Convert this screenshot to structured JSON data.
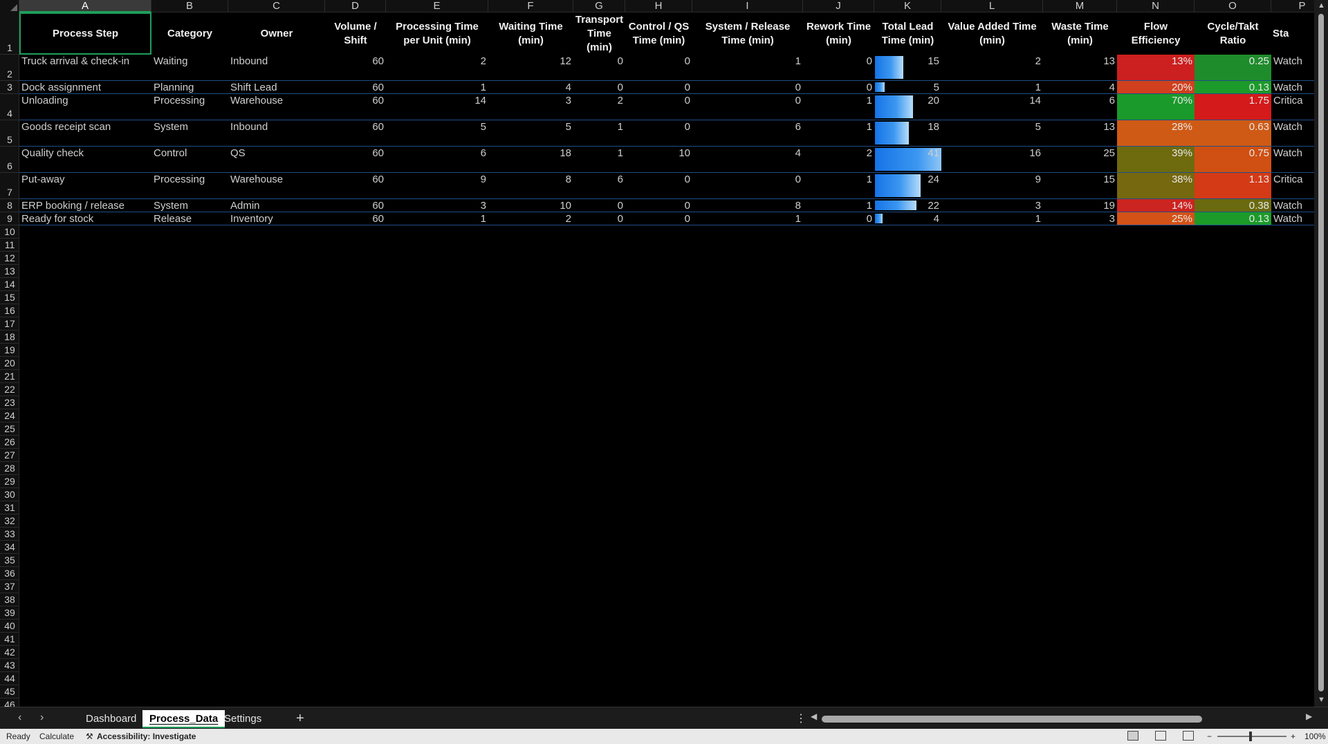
{
  "columns": [
    "A",
    "B",
    "C",
    "D",
    "E",
    "F",
    "G",
    "H",
    "I",
    "J",
    "K",
    "L",
    "M",
    "N",
    "O",
    "P"
  ],
  "headers": [
    "Process Step",
    "Category",
    "Owner",
    "Volume / Shift",
    "Processing Time per Unit (min)",
    "Waiting Time (min)",
    "Transport Time (min)",
    "Control / QS Time (min)",
    "System / Release Time (min)",
    "Rework Time (min)",
    "Total Lead Time (min)",
    "Value Added Time (min)",
    "Waste Time (min)",
    "Flow Efficiency",
    "Cycle/Takt Ratio",
    "Sta"
  ],
  "rows": [
    {
      "cells": [
        "Truck arrival & check-in",
        "Waiting",
        "Inbound",
        "60",
        "2",
        "12",
        "0",
        "0",
        "1",
        "0",
        "15",
        "2",
        "13",
        "13%",
        "0.25",
        "Watch"
      ],
      "lead_bar_fraction": 0.366,
      "flow_color": "#cc1f1f",
      "ratio_color": "#1f8c2c"
    },
    {
      "cells": [
        "Dock assignment",
        "Planning",
        "Shift Lead",
        "60",
        "1",
        "4",
        "0",
        "0",
        "0",
        "0",
        "5",
        "1",
        "4",
        "20%",
        "0.13",
        "Watch"
      ],
      "lead_bar_fraction": 0.122,
      "flow_color": "#d0401e",
      "ratio_color": "#1c9a2a"
    },
    {
      "cells": [
        "Unloading",
        "Processing",
        "Warehouse",
        "60",
        "14",
        "3",
        "2",
        "0",
        "0",
        "1",
        "20",
        "14",
        "6",
        "70%",
        "1.75",
        "Critica"
      ],
      "lead_bar_fraction": 0.488,
      "flow_color": "#1a9a2a",
      "ratio_color": "#d41a1a"
    },
    {
      "cells": [
        "Goods receipt scan",
        "System",
        "Inbound",
        "60",
        "5",
        "5",
        "1",
        "0",
        "6",
        "1",
        "18",
        "5",
        "13",
        "28%",
        "0.63",
        "Watch"
      ],
      "lead_bar_fraction": 0.439,
      "flow_color": "#cf5a15",
      "ratio_color": "#cf5a15"
    },
    {
      "cells": [
        "Quality check",
        "Control",
        "QS",
        "60",
        "6",
        "18",
        "1",
        "10",
        "4",
        "2",
        "41",
        "16",
        "25",
        "39%",
        "0.75",
        "Watch"
      ],
      "lead_bar_fraction": 1.0,
      "flow_color": "#6e6a0e",
      "ratio_color": "#cf5012"
    },
    {
      "cells": [
        "Put-away",
        "Processing",
        "Warehouse",
        "60",
        "9",
        "8",
        "6",
        "0",
        "0",
        "1",
        "24",
        "9",
        "15",
        "38%",
        "1.13",
        "Critica"
      ],
      "lead_bar_fraction": 0.585,
      "flow_color": "#76680e",
      "ratio_color": "#d43a16"
    },
    {
      "cells": [
        "ERP booking / release",
        "System",
        "Admin",
        "60",
        "3",
        "10",
        "0",
        "0",
        "8",
        "1",
        "22",
        "3",
        "19",
        "14%",
        "0.38",
        "Watch"
      ],
      "lead_bar_fraction": 0.537,
      "flow_color": "#cc2420",
      "ratio_color": "#6a6a10"
    },
    {
      "cells": [
        "Ready for stock",
        "Release",
        "Inventory",
        "60",
        "1",
        "2",
        "0",
        "0",
        "1",
        "0",
        "4",
        "1",
        "3",
        "25%",
        "0.13",
        "Watch"
      ],
      "lead_bar_fraction": 0.098,
      "flow_color": "#d35217",
      "ratio_color": "#1c9a2a"
    }
  ],
  "row_numbers": [
    "1",
    "2",
    "3",
    "4",
    "5",
    "6",
    "7",
    "8",
    "9",
    "10",
    "11",
    "12",
    "13",
    "14",
    "15",
    "16",
    "17",
    "18",
    "19",
    "20",
    "21",
    "22",
    "23",
    "24",
    "25",
    "26",
    "27",
    "28",
    "29",
    "30",
    "31",
    "32",
    "33",
    "34",
    "35",
    "36",
    "37",
    "38",
    "39",
    "40",
    "41",
    "42",
    "43",
    "44",
    "45",
    "46"
  ],
  "sheet_tabs": [
    {
      "label": "Dashboard",
      "active": false
    },
    {
      "label": "Process_Data",
      "active": true
    },
    {
      "label": "Settings",
      "active": false
    }
  ],
  "status": {
    "ready": "Ready",
    "calculate": "Calculate",
    "accessibility": "Accessibility: Investigate",
    "zoom": "100%"
  },
  "icons": {
    "prev_sheet": "chevron-left-icon",
    "next_sheet": "chevron-right-icon",
    "add_sheet": "plus-icon",
    "more": "vertical-dots-icon",
    "accessibility": "accessibility-icon"
  },
  "colors": {
    "selection": "#1f9e5b",
    "row_border": "#1f4f8a",
    "bar_start": "#1673e6",
    "bar_end": "#b7dcfb"
  }
}
